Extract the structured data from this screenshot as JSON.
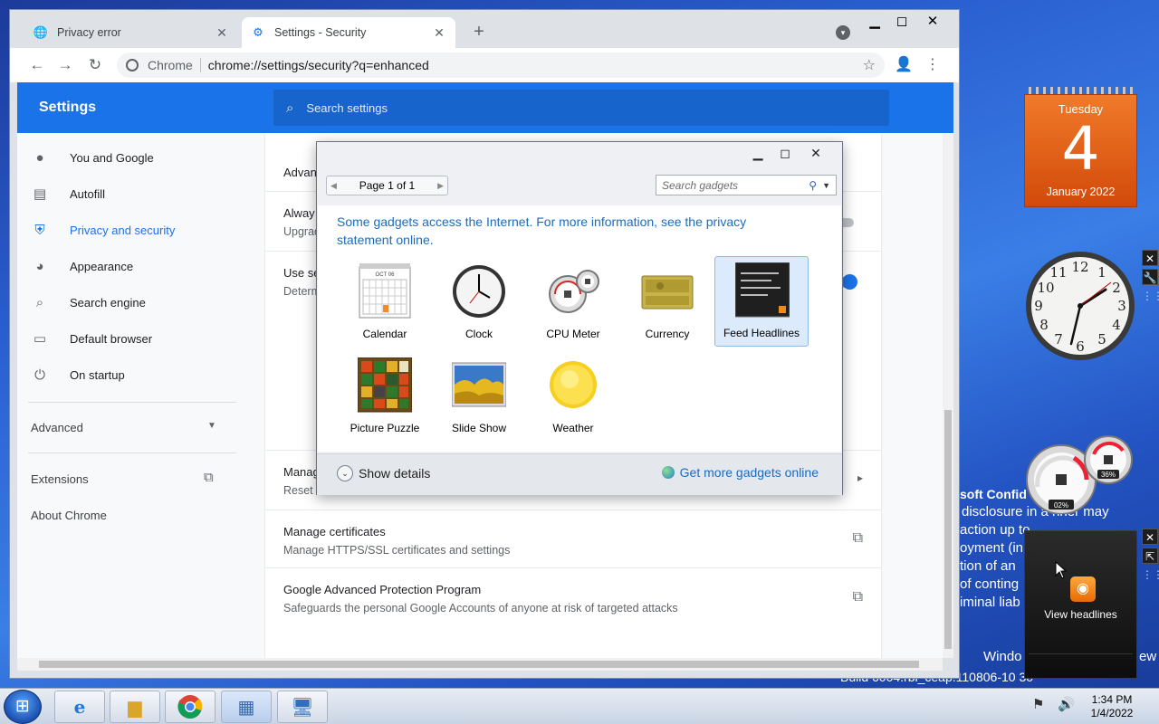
{
  "browser": {
    "tabs": [
      {
        "title": "Privacy error",
        "icon": "globe-icon"
      },
      {
        "title": "Settings - Security",
        "icon": "gear-icon"
      }
    ],
    "omnibox": {
      "chip": "Chrome",
      "url": "chrome://settings/security?q=enhanced"
    }
  },
  "settings": {
    "title": "Settings",
    "search_placeholder": "Search settings",
    "sidebar": [
      {
        "label": "You and Google",
        "icon": "person-icon"
      },
      {
        "label": "Autofill",
        "icon": "clipboard-icon"
      },
      {
        "label": "Privacy and security",
        "icon": "shield-icon",
        "active": true
      },
      {
        "label": "Appearance",
        "icon": "palette-icon"
      },
      {
        "label": "Search engine",
        "icon": "search-icon"
      },
      {
        "label": "Default browser",
        "icon": "browser-icon"
      },
      {
        "label": "On startup",
        "icon": "power-icon"
      }
    ],
    "advanced": "Advanced",
    "extensions": "Extensions",
    "about": "About Chrome",
    "content": {
      "partial_advanced": "Advan",
      "partial_always": "Alway",
      "partial_upgrade": "Upgrad",
      "partial_use": "Use se",
      "partial_determine": "Determ",
      "partial_manage": "Manag",
      "partial_reset": "Reset",
      "cert_title": "Manage certificates",
      "cert_sub": "Manage HTTPS/SSL certificates and settings",
      "gapp_title": "Google Advanced Protection Program",
      "gapp_sub": "Safeguards the personal Google Accounts of anyone at risk of targeted attacks"
    }
  },
  "gadgets_dialog": {
    "pager": "Page 1 of 1",
    "search_placeholder": "Search gadgets",
    "notice": "Some gadgets access the Internet.  For more information, see the privacy statement online.",
    "items": [
      {
        "label": "Calendar"
      },
      {
        "label": "Clock"
      },
      {
        "label": "CPU Meter"
      },
      {
        "label": "Currency"
      },
      {
        "label": "Feed Headlines",
        "selected": true
      },
      {
        "label": "Picture Puzzle"
      },
      {
        "label": "Slide Show"
      },
      {
        "label": "Weather"
      }
    ],
    "calendar_month_label": "OCT 06",
    "show_details": "Show details",
    "get_more": "Get more gadgets online"
  },
  "desktop": {
    "calendar": {
      "weekday": "Tuesday",
      "day": "4",
      "month_year": "January 2022"
    },
    "cpu_meter": {
      "cpu": "02%",
      "memory": "36%"
    },
    "feed": {
      "label": "View headlines"
    },
    "wallpaper_lines": {
      "title": "soft Confid",
      "line1": "disclosure in a         nner may",
      "line2": "action up to              ",
      "line3": "oyment (in",
      "line4": "tion of an",
      "line5": "of conting",
      "line6": "iminal liab",
      "windows": "Windo",
      "windows_right": "ew",
      "build": "Build 6004.rbl_ceap.110806-10         30"
    }
  },
  "taskbar": {
    "time": "1:34 PM",
    "date": "1/4/2022",
    "apps": [
      "ie-icon",
      "explorer-icon",
      "chrome-icon",
      "gadgets-icon",
      "remote-desktop-icon"
    ]
  },
  "colors": {
    "chrome_blue": "#1a73e8",
    "calendar_orange": "#e8621a",
    "link_blue": "#1a6cc0"
  }
}
